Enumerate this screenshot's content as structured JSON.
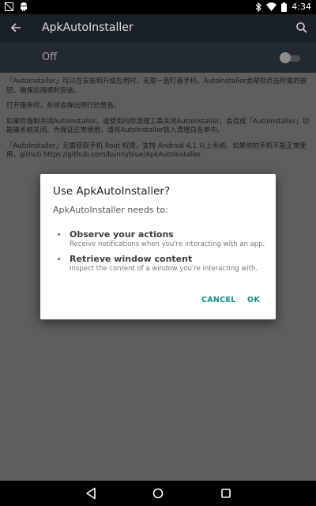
{
  "status_bar": {
    "time": "4:34",
    "icons": [
      "screenshot-icon",
      "android-icon",
      "bluetooth-icon",
      "wifi-icon",
      "battery-icon"
    ]
  },
  "toolbar": {
    "title": "ApkAutoInstaller",
    "icons": [
      "back-arrow-icon",
      "search-icon"
    ]
  },
  "switch_bar": {
    "label": "Off",
    "enabled": false
  },
  "description": {
    "para1": "「AutoInstaller」可以在安装和升级应用时，无需一直盯着手机，AutoInstaller会帮你点击所需的按钮，确保应用顺利安装。",
    "para2": "打开服务时，系统会弹出例行的警告。",
    "para3": "如果你强制关闭AutoInstaller，或使用内存清理工具关闭AutoInstaller，会造成「AutoInstaller」功能被系统关闭。为保证正常使用，请将AutoInstaller放入清理白名单中。",
    "para4": "「AutoInstaller」无需获取手机 Root 权限，支持 Android 4.1 以上系统。如果你的手机不能正常使用，github https://github.com/bunnyblue/ApkAutoInstaller"
  },
  "dialog": {
    "title": "Use ApkAutoInstaller?",
    "subtitle": "ApkAutoInstaller needs to:",
    "permissions": [
      {
        "title": "Observe your actions",
        "description": "Receive notifications when you're interacting with an app."
      },
      {
        "title": "Retrieve window content",
        "description": "Inspect the content of a window you're interacting with."
      }
    ],
    "cancel_label": "CANCEL",
    "ok_label": "OK",
    "accent_color": "#149487"
  },
  "nav_bar": {
    "icons": [
      "back-triangle-icon",
      "home-circle-icon",
      "recents-square-icon"
    ]
  }
}
